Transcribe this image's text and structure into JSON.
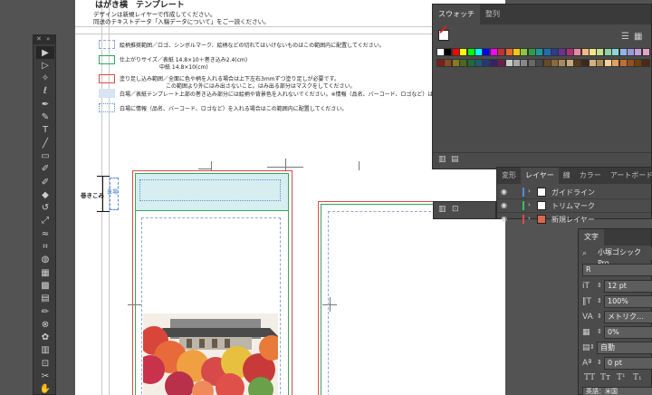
{
  "document": {
    "heading": "はがき横　テンプレート",
    "line1": "デザインは新規レイヤーで作成してください。",
    "line2": "同送のテキストデータ「入稿データについて」をご一読ください。",
    "legend": [
      {
        "text": "絵柄推奨範囲／ロゴ、シンボルマーク、絵柄などの切れてはいけないものはこの範囲内に配置してください。",
        "color": "#8fa8d8",
        "style": "dashed"
      },
      {
        "text": "仕上がりサイズ／表紙 14.8×10＋巻き込み2.4(cm)",
        "text2": "中紙 14.8×10(cm)",
        "color": "#2ea860",
        "style": "solid"
      },
      {
        "text": "塗り足し込み範囲／全面に色や柄を入れる場合は上下左右3mmずつ塗り足しが必要です。",
        "text2": "この範囲より外にはみ出さないこと。はみ出る部分はマスクをしてください。",
        "color": "#e04848",
        "style": "solid"
      },
      {
        "text": "白場／表紙テンプレート上部の巻き込み部分には絵柄や背景色を入れないでください。※情報（品名、バーコード、ロゴなど）は可。",
        "color": "#d8e4f4",
        "style": "fill"
      },
      {
        "text": "白場に情報（品名、バーコード、ロゴなど）を入れる場合はこの範囲内に配置してください。",
        "color": "#5a8fd8",
        "style": "dotted"
      }
    ],
    "wrap_label": "巻きこみ",
    "white_label": "白場"
  },
  "toolbar": {
    "tools": [
      "select-icon",
      "direct-select-icon",
      "magic-wand-icon",
      "lasso-icon",
      "pen-icon",
      "curvature-icon",
      "type-icon",
      "line-icon",
      "rectangle-icon",
      "paintbrush-icon",
      "shaper-icon",
      "eraser-icon",
      "rotate-icon",
      "scale-icon",
      "width-icon",
      "free-transform-icon",
      "shape-builder-icon",
      "perspective-icon",
      "mesh-icon",
      "gradient-icon",
      "eyedropper-icon",
      "blend-icon",
      "symbol-sprayer-icon",
      "column-graph-icon",
      "artboard-icon",
      "slice-icon",
      "hand-icon"
    ],
    "glyphs": [
      "▶",
      "▷",
      "✧",
      "ℓ",
      "✒",
      "✎",
      "T",
      "╱",
      "▭",
      "✐",
      "✐",
      "◆",
      "↺",
      "⤢",
      "≈",
      "⌗",
      "◍",
      "▦",
      "▩",
      "▤",
      "✏",
      "⊗",
      "✿",
      "▥",
      "⊡",
      "✂",
      "✋"
    ]
  },
  "swatches_panel": {
    "tabs": [
      "スウォッチ",
      "整列"
    ],
    "colors": [
      "#ffffff",
      "#000000",
      "#ff0000",
      "#ffff00",
      "#00ff00",
      "#00ffff",
      "#0000ff",
      "#ff00ff",
      "#c43030",
      "#e86a2a",
      "#f5c518",
      "#8dc63f",
      "#2e9e46",
      "#1c9aa0",
      "#1c6fb5",
      "#2a3d8f",
      "#6a3392",
      "#b0307a",
      "#e88aa0",
      "#f2b880",
      "#f7e48a",
      "#c4e08a",
      "#8fd4a0",
      "#8cd6d8",
      "#8fb6e4",
      "#9a9ad8",
      "#c2a0d8",
      "#e4a2c8",
      "#7a1f1f",
      "#8a4a1f",
      "#8a7a1f",
      "#4a6a1f",
      "#1f6a3a",
      "#1f5a6a",
      "#1f3a7a",
      "#3a1f6a",
      "#6a1f4a",
      "#c8c8c8",
      "#a8a8a8",
      "#888888",
      "#686868",
      "#484848",
      "#6b4a2a",
      "#8a6a3a",
      "#a88a5a",
      "#c8aa7a",
      "#5a3a1a",
      "#3a2a1a",
      "#d4b080",
      "#b08a50",
      "#f0d0a0",
      "#e0a060",
      "#c07030",
      "#905020",
      "#704010",
      "#502810"
    ]
  },
  "layers_panel": {
    "tabs": [
      "変形",
      "レイヤー",
      "線",
      "カラー",
      "アートボード"
    ],
    "layers": [
      {
        "name": "ガイドライン",
        "color": "#4a8ff0"
      },
      {
        "name": "トリムマーク",
        "color": "#2ec860"
      },
      {
        "name": "新規レイヤー",
        "color": "#e04848"
      }
    ]
  },
  "character_panel": {
    "tab": "文字",
    "font_family": "小塚ゴシック Pro",
    "font_style": "R",
    "font_size": "12 pt",
    "vertical_scale": "100%",
    "kerning": "メトリク…",
    "tsume": "0%",
    "auto_leading": "自動",
    "baseline": "0 pt",
    "type_buttons": [
      "TT",
      "Tт",
      "T¹",
      "T₁"
    ],
    "language": "英語：米国"
  }
}
